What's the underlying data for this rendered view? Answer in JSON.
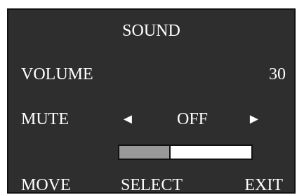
{
  "menu": {
    "title": "SOUND",
    "volume": {
      "label": "VOLUME",
      "value": "30"
    },
    "mute": {
      "label": "MUTE",
      "left_arrow": "◄",
      "value": "OFF",
      "right_arrow": "►"
    },
    "level_bar": {
      "fill_fraction": 0.39
    },
    "footer": {
      "move": "MOVE",
      "select": "SELECT",
      "exit": "EXIT"
    }
  },
  "colors": {
    "panel_bg": "#2e2e2e",
    "text": "#ffffff",
    "bar_fill": "#999999",
    "bar_empty": "#ffffff"
  }
}
